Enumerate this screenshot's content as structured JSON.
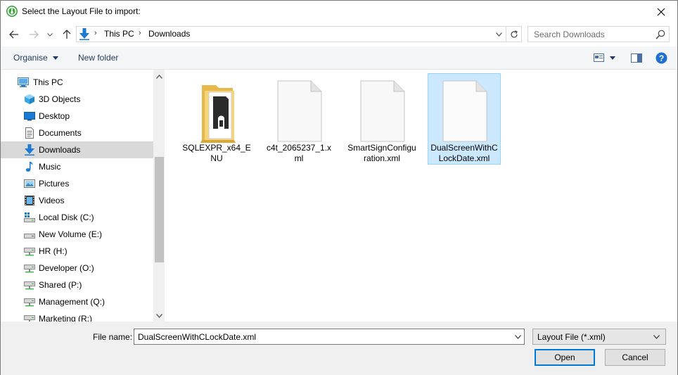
{
  "window": {
    "title": "Select the Layout File to import:"
  },
  "address": {
    "crumbs": [
      "This PC",
      "Downloads"
    ]
  },
  "search": {
    "placeholder": "Search Downloads"
  },
  "toolbar": {
    "organise_label": "Organise",
    "new_folder_label": "New folder"
  },
  "navigation": {
    "items": [
      {
        "label": "This PC",
        "icon": "computer-icon",
        "level": 0
      },
      {
        "label": "3D Objects",
        "icon": "cube-icon",
        "level": 1
      },
      {
        "label": "Desktop",
        "icon": "desktop-icon",
        "level": 1
      },
      {
        "label": "Documents",
        "icon": "document-icon",
        "level": 1
      },
      {
        "label": "Downloads",
        "icon": "download-arrow-icon",
        "level": 1,
        "selected": true
      },
      {
        "label": "Music",
        "icon": "music-note-icon",
        "level": 1
      },
      {
        "label": "Pictures",
        "icon": "picture-icon",
        "level": 1
      },
      {
        "label": "Videos",
        "icon": "film-icon",
        "level": 1
      },
      {
        "label": "Local Disk (C:)",
        "icon": "windows-drive-icon",
        "level": 1
      },
      {
        "label": "New Volume (E:)",
        "icon": "drive-icon",
        "level": 1
      },
      {
        "label": "HR (H:)",
        "icon": "network-drive-icon",
        "level": 1
      },
      {
        "label": "Developer (O:)",
        "icon": "network-drive-icon",
        "level": 1
      },
      {
        "label": "Shared (P:)",
        "icon": "network-drive-icon",
        "level": 1
      },
      {
        "label": "Management (Q:)",
        "icon": "network-drive-icon",
        "level": 1
      },
      {
        "label": "Marketing (R:)",
        "icon": "network-drive-icon",
        "level": 1
      }
    ]
  },
  "files": [
    {
      "name": "SQLEXPR_x64_ENU",
      "icon": "zip-folder-icon",
      "selected": false
    },
    {
      "name": "c4t_2065237_1.xml",
      "icon": "blank-file-icon",
      "selected": false
    },
    {
      "name": "SmartSignConfiguration.xml",
      "icon": "blank-file-icon",
      "selected": false
    },
    {
      "name": "DualScreenWithCLockDate.xml",
      "icon": "blank-file-icon",
      "selected": true
    }
  ],
  "bottom": {
    "filename_label": "File name:",
    "filename_value": "DualScreenWithCLockDate.xml",
    "filetype_value": "Layout File (*.xml)",
    "open_label": "Open",
    "cancel_label": "Cancel"
  },
  "colors": {
    "accent": "#0078d7",
    "selection_bg": "#cce8ff",
    "selection_border": "#99d1ff",
    "nav_selected_bg": "#d9d9d9",
    "help_blue": "#1e6fcf"
  }
}
